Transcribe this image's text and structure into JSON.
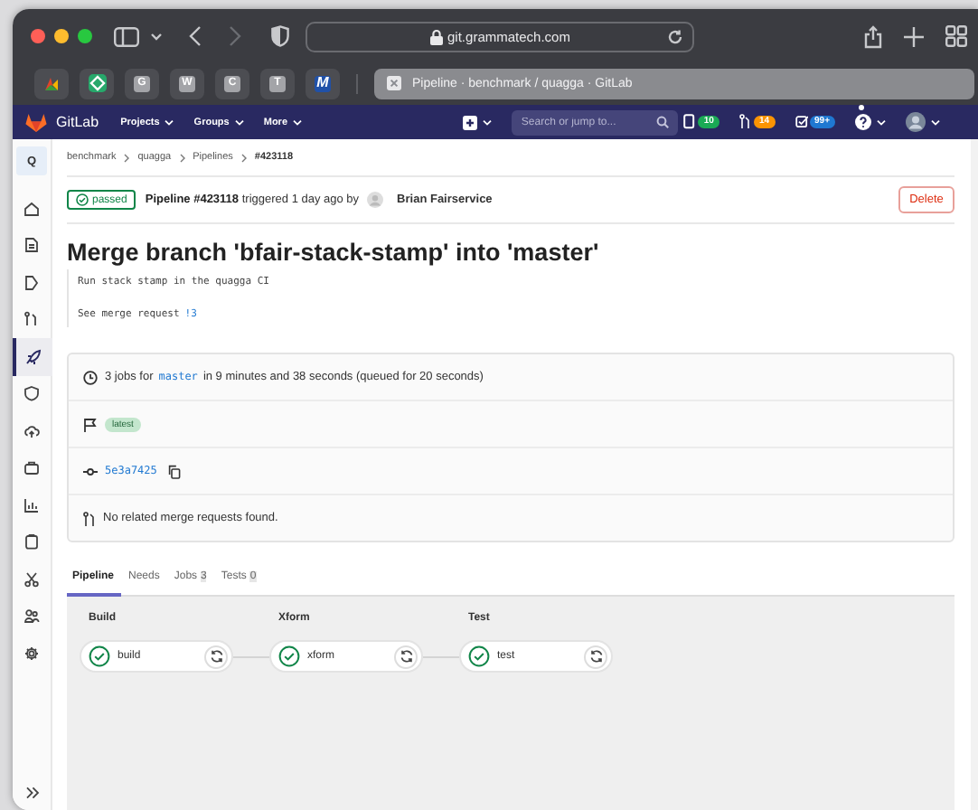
{
  "browser": {
    "url": "git.grammatech.com",
    "bookmarks": [
      {
        "kind": "image"
      },
      {
        "kind": "image"
      },
      {
        "kind": "letter",
        "label": "G"
      },
      {
        "kind": "letter",
        "label": "W"
      },
      {
        "kind": "letter",
        "label": "C"
      },
      {
        "kind": "letter",
        "label": "T"
      },
      {
        "kind": "letter",
        "label": "M"
      }
    ],
    "tab_title": "Pipeline · benchmark / quagga · GitLab"
  },
  "navbar": {
    "logo": "GitLab",
    "menus": [
      "Projects",
      "Groups",
      "More"
    ],
    "search": {
      "placeholder": "Search or jump to..."
    },
    "counters": [
      {
        "count": "10",
        "color": "#1aaa55"
      },
      {
        "count": "14",
        "color": "#fc9403"
      },
      {
        "count": "99+",
        "color": "#1f78d1"
      }
    ]
  },
  "sidebar": {
    "project_letter": "Q",
    "items": [
      {
        "selected": false
      },
      {
        "selected": false
      },
      {
        "selected": false
      },
      {
        "selected": false
      },
      {
        "selected": true
      },
      {
        "selected": false
      },
      {
        "selected": false
      },
      {
        "selected": false
      },
      {
        "selected": false
      },
      {
        "selected": false
      },
      {
        "selected": false
      },
      {
        "selected": false
      },
      {
        "selected": false
      }
    ]
  },
  "breadcrumb": [
    "benchmark",
    "quagga",
    "Pipelines",
    "#423118"
  ],
  "header": {
    "status": "passed",
    "summary": "**Pipeline #423118** triggered 1 day ago by",
    "user": "Brian Fairservice",
    "button": "Delete"
  },
  "title": "Merge branch 'bfair-stack-stamp' into 'master'",
  "commit_message": {
    "line": "Run stack stamp in the quagga CI",
    "see": "See merge request",
    "link": "!3"
  },
  "info": {
    "jobs": "3 jobs for",
    "ref": "master",
    "duration": "in 9 minutes and 38 seconds (queued for 20 seconds)",
    "badge": "latest",
    "sha": "5e3a7425",
    "merge_requests": "No related merge requests found."
  },
  "tabs": [
    {
      "label": "Pipeline",
      "selected": true
    },
    {
      "label": "Needs",
      "selected": false
    },
    {
      "label": "Jobs",
      "count": "3",
      "selected": false
    },
    {
      "label": "Tests",
      "count": "0",
      "selected": false
    }
  ],
  "stages": [
    {
      "name": "Build",
      "jobs": [
        {
          "name": "build",
          "passed": true
        }
      ]
    },
    {
      "name": "Xform",
      "jobs": [
        {
          "name": "xform",
          "passed": true
        }
      ]
    },
    {
      "name": "Test",
      "jobs": [
        {
          "name": "test",
          "passed": true
        }
      ]
    }
  ]
}
